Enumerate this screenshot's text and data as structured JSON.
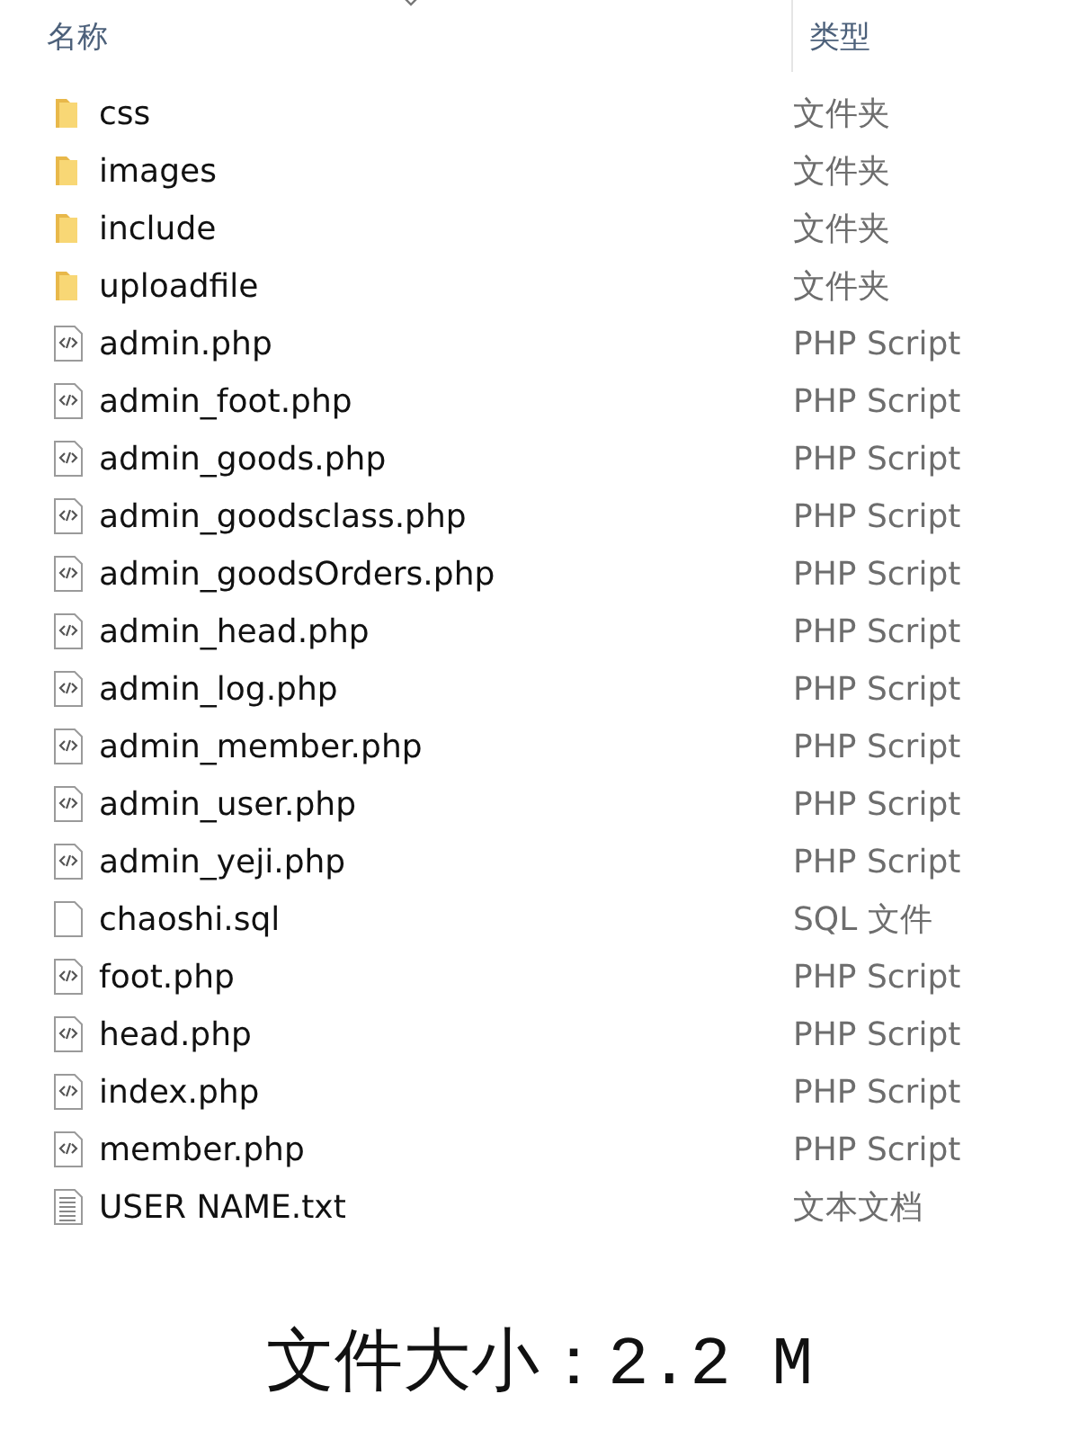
{
  "columns": [
    "名称",
    "类型"
  ],
  "files": [
    {
      "name": "css",
      "type": "文件夹",
      "kind": "folder"
    },
    {
      "name": "images",
      "type": "文件夹",
      "kind": "folder"
    },
    {
      "name": "include",
      "type": "文件夹",
      "kind": "folder"
    },
    {
      "name": "uploadfile",
      "type": "文件夹",
      "kind": "folder"
    },
    {
      "name": "admin.php",
      "type": "PHP Script",
      "kind": "php"
    },
    {
      "name": "admin_foot.php",
      "type": "PHP Script",
      "kind": "php"
    },
    {
      "name": "admin_goods.php",
      "type": "PHP Script",
      "kind": "php"
    },
    {
      "name": "admin_goodsclass.php",
      "type": "PHP Script",
      "kind": "php"
    },
    {
      "name": "admin_goodsOrders.php",
      "type": "PHP Script",
      "kind": "php"
    },
    {
      "name": "admin_head.php",
      "type": "PHP Script",
      "kind": "php"
    },
    {
      "name": "admin_log.php",
      "type": "PHP Script",
      "kind": "php"
    },
    {
      "name": "admin_member.php",
      "type": "PHP Script",
      "kind": "php"
    },
    {
      "name": "admin_user.php",
      "type": "PHP Script",
      "kind": "php"
    },
    {
      "name": "admin_yeji.php",
      "type": "PHP Script",
      "kind": "php"
    },
    {
      "name": "chaoshi.sql",
      "type": "SQL 文件",
      "kind": "sql"
    },
    {
      "name": "foot.php",
      "type": "PHP Script",
      "kind": "php"
    },
    {
      "name": "head.php",
      "type": "PHP Script",
      "kind": "php"
    },
    {
      "name": "index.php",
      "type": "PHP Script",
      "kind": "php"
    },
    {
      "name": "member.php",
      "type": "PHP Script",
      "kind": "php"
    },
    {
      "name": "USER NAME.txt",
      "type": "文本文档",
      "kind": "txt"
    }
  ],
  "caption": "文件大小：2.2 M"
}
